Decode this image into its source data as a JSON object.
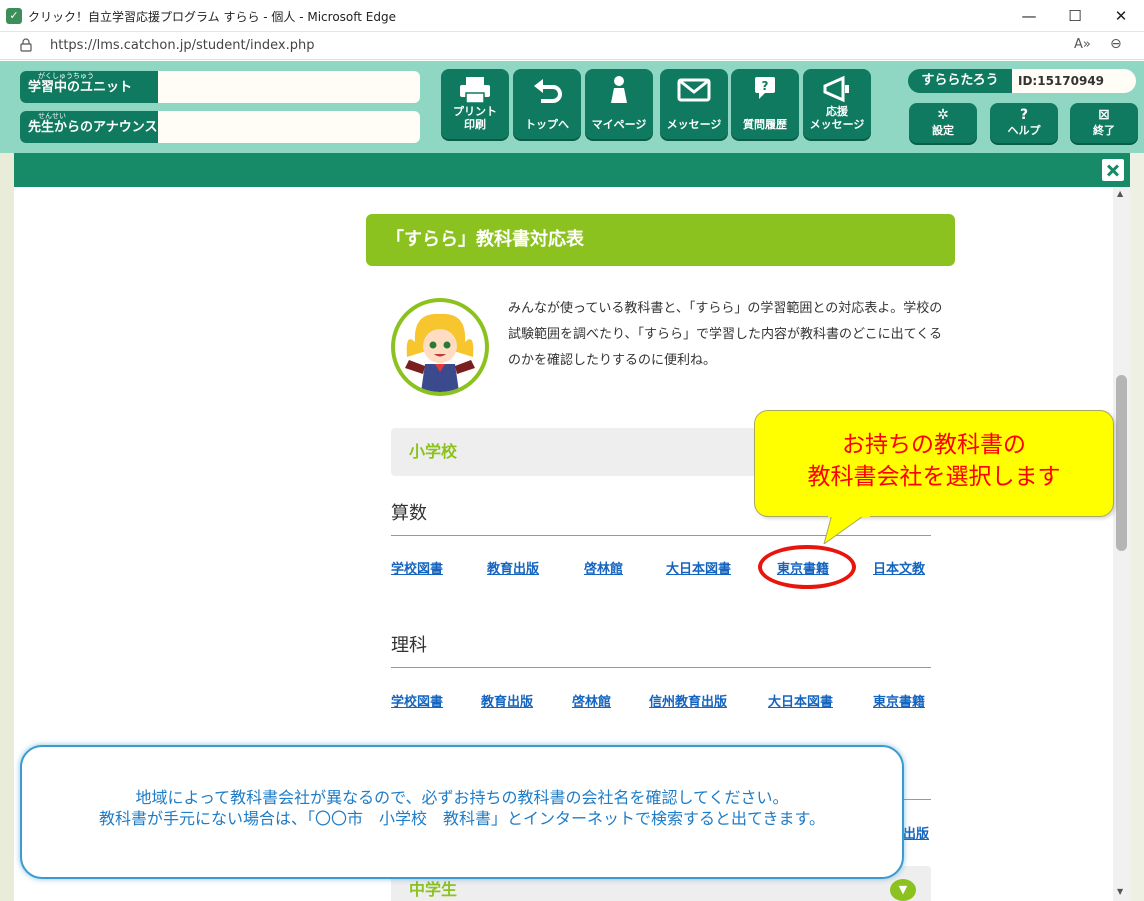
{
  "window": {
    "title": "クリック！自立学習応援プログラム すらら - 個人 - Microsoft Edge",
    "min_glyph": "—",
    "max_glyph": "☐",
    "close_glyph": "✕"
  },
  "address_bar": {
    "url": "https://lms.catchon.jp/student/index.php",
    "read_aloud_glyph": "A»",
    "zoom_glyph": "⊖"
  },
  "header": {
    "current_unit_label": "学習中のユニット",
    "current_unit_ruby": "がくしゅうちゅう",
    "current_unit_value": "",
    "announce_label": "先生からのアナウンス",
    "announce_ruby": "せんせい",
    "announce_value": "",
    "tools": [
      {
        "label1": "プリント",
        "label2": "印刷",
        "icon": "printer-icon"
      },
      {
        "label1": "",
        "label2": "トップへ",
        "icon": "return-icon"
      },
      {
        "label1": "",
        "label2": "マイページ",
        "icon": "person-icon"
      },
      {
        "label1": "",
        "label2": "メッセージ",
        "icon": "mail-icon"
      },
      {
        "label1": "",
        "label2": "質問履歴",
        "icon": "question-history-icon"
      },
      {
        "label1": "応援",
        "label2": "メッセージ",
        "icon": "megaphone-icon"
      }
    ],
    "user_name": "すららたろう",
    "user_id": "ID:15170949",
    "settings_label": "設定",
    "help_label": "ヘルプ",
    "help_glyph": "?",
    "exit_label": "終了"
  },
  "content": {
    "heading": "「すらら」教科書対応表",
    "intro": "みんなが使っている教科書と、「すらら」の学習範囲との対応表よ。学校の試験範囲を調べたり、「すらら」で学習した内容が教科書のどこに出てくるのかを確認したりするのに便利ね。",
    "elementary_label": "小学校",
    "jhs_label": "中学生",
    "jhs_toggle_glyph": "▼",
    "math": {
      "subject": "算数",
      "publishers": [
        "学校図書",
        "教育出版",
        "啓林館",
        "大日本図書",
        "東京書籍",
        "日本文教"
      ]
    },
    "science": {
      "subject": "理科",
      "publishers": [
        "学校図書",
        "教育出版",
        "啓林館",
        "信州教育出版",
        "大日本図書",
        "東京書籍"
      ]
    },
    "partial_link": "出版"
  },
  "annotations": {
    "callout_line1": "お持ちの教科書の",
    "callout_line2": "教科書会社を選択します",
    "note_line1": "地域によって教科書会社が異なるので、必ずお持ちの教科書の会社名を確認してください。",
    "note_line2": "教科書が手元にない場合は、「〇〇市　小学校　教科書」とインターネットで検索すると出てきます。"
  },
  "colors": {
    "header_bg": "#8fd6c3",
    "header_dark": "#0f7a5f",
    "accent_green": "#8cc21f",
    "link_blue": "#1565c0",
    "callout_yellow": "#ffff00",
    "callout_red": "#ff0000",
    "note_blue": "#1f7cc6"
  }
}
